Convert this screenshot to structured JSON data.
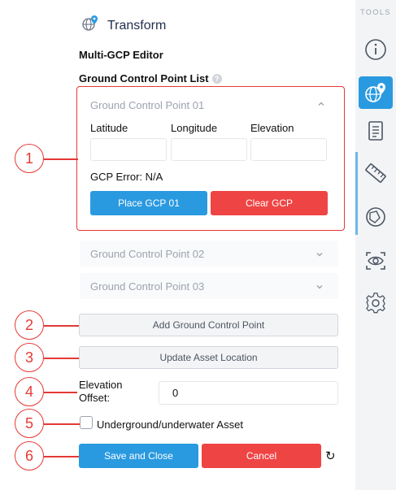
{
  "header": {
    "title": "Transform",
    "icon": "globe-pin-icon"
  },
  "editor": {
    "title": "Multi-GCP Editor",
    "list_label": "Ground Control Point List",
    "help_glyph": "?"
  },
  "gcp_list": [
    {
      "name": "Ground Control Point 01",
      "expanded": true,
      "fields": {
        "latitude_label": "Latitude",
        "longitude_label": "Longitude",
        "elevation_label": "Elevation",
        "latitude_value": "",
        "longitude_value": "",
        "elevation_value": ""
      },
      "error": "GCP Error: N/A",
      "place_button": "Place GCP 01",
      "clear_button": "Clear GCP"
    },
    {
      "name": "Ground Control Point 02",
      "expanded": false
    },
    {
      "name": "Ground Control Point 03",
      "expanded": false
    }
  ],
  "actions": {
    "add_gcp": "Add Ground Control Point",
    "update_location": "Update Asset Location"
  },
  "elevation_offset": {
    "label": "Elevation Offset:",
    "value": "0"
  },
  "underground": {
    "label": "Underground/underwater Asset",
    "checked": false
  },
  "footer": {
    "save": "Save and Close",
    "cancel": "Cancel",
    "reset_glyph": "↻"
  },
  "callouts": [
    "1",
    "2",
    "3",
    "4",
    "5",
    "6"
  ],
  "sidebar": {
    "label": "TOOLS",
    "items": [
      {
        "icon": "info-icon",
        "active": false
      },
      {
        "icon": "globe-pin-icon",
        "active": true
      },
      {
        "icon": "document-icon",
        "active": false
      },
      {
        "icon": "ruler-icon",
        "active": false
      },
      {
        "icon": "shape-icon",
        "active": false
      },
      {
        "icon": "eye-scan-icon",
        "active": false
      },
      {
        "icon": "settings-icon",
        "active": false
      }
    ]
  },
  "colors": {
    "accent": "#2a9ae0",
    "danger": "#ef4444",
    "callout": "#e53935"
  }
}
